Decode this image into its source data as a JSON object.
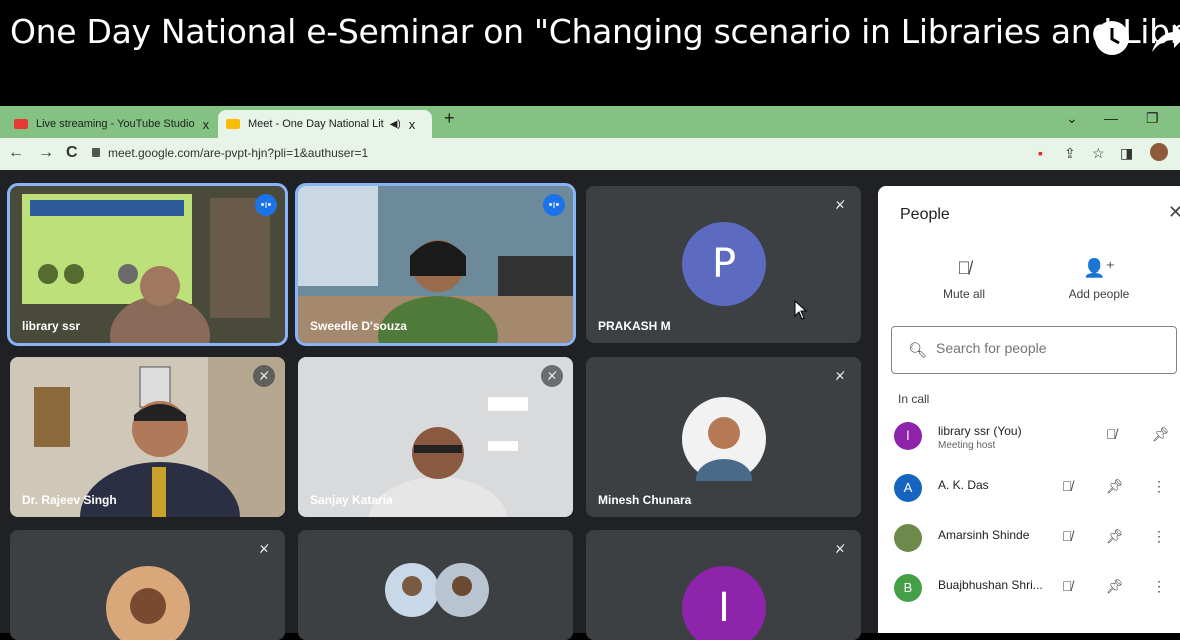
{
  "video": {
    "title": "One Day National e-Seminar on \"Changing scenario in Libraries and Libra...",
    "watch_later_icon": "clock-icon",
    "share_icon": "share-arrow-icon"
  },
  "browser": {
    "tabs": [
      {
        "label": "Live streaming - YouTube Studio",
        "icon": "youtube-icon",
        "close": "x"
      },
      {
        "label": "Meet - One Day National Lit",
        "icon": "meet-icon",
        "close": "x"
      }
    ],
    "new_tab": "+",
    "url": "meet.google.com/are-pvpt-hjn?pli=1&authuser=1",
    "nav": {
      "back": "←",
      "forward": "→",
      "reload": "C"
    }
  },
  "tiles": [
    {
      "name": "library ssr",
      "state": "speaking"
    },
    {
      "name": "Sweedle D'souza",
      "state": "speaking"
    },
    {
      "name": "PRAKASH M",
      "state": "muted",
      "avatar_letter": "P",
      "avatar_color": "#5c6bc0"
    },
    {
      "name": "Dr. Rajeev Singh",
      "state": "muted"
    },
    {
      "name": "Sanjay Kataria",
      "state": "muted"
    },
    {
      "name": "Minesh Chunara",
      "state": "muted"
    },
    {
      "name": "",
      "state": "muted"
    },
    {
      "name": "",
      "state": "none"
    },
    {
      "name": "",
      "state": "muted",
      "avatar_letter": "I",
      "avatar_color": "#8e24aa"
    }
  ],
  "people_panel": {
    "title": "People",
    "mute_all": "Mute all",
    "add_people": "Add people",
    "search_placeholder": "Search for people",
    "in_call_label": "In call",
    "participants": [
      {
        "name": "library ssr (You)",
        "subtitle": "Meeting host",
        "avatar_letter": "l",
        "avatar_color": "#8e24aa"
      },
      {
        "name": "A. K. Das",
        "avatar_letter": "A",
        "avatar_color": "#1565c0"
      },
      {
        "name": "Amarsinh Shinde",
        "avatar_letter": "",
        "avatar_color": "#6d8a4a"
      },
      {
        "name": "Buajbhushan Shri...",
        "avatar_letter": "B",
        "avatar_color": "#43a047"
      }
    ]
  },
  "colors": {
    "tab_bar": "#83c283",
    "meet_bg": "#202124",
    "tile_bg": "#3c4043",
    "speaking_outline": "#8ab4f8"
  }
}
